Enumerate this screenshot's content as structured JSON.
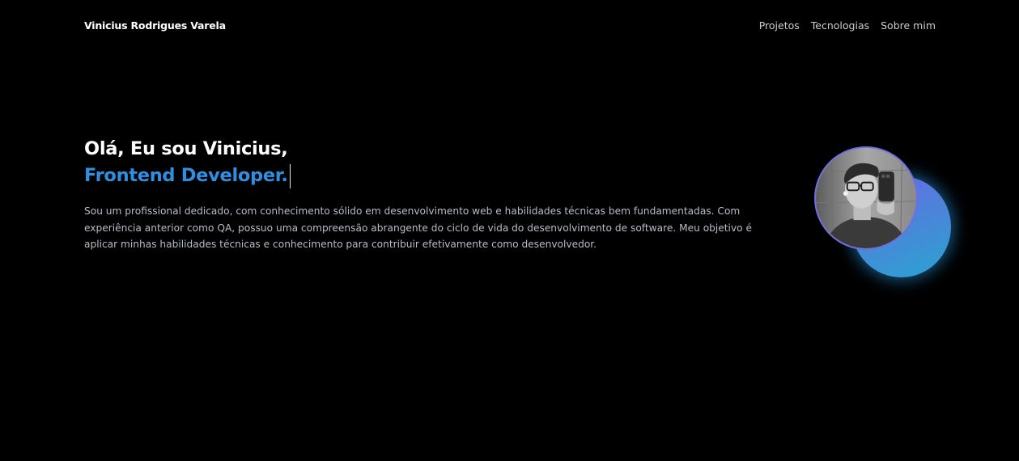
{
  "header": {
    "brand": "Vinicius Rodrigues Varela",
    "nav": [
      {
        "label": "Projetos"
      },
      {
        "label": "Tecnologias"
      },
      {
        "label": "Sobre mim"
      }
    ]
  },
  "hero": {
    "greeting": "Olá, Eu sou Vinicius,",
    "role": "Frontend Developer.",
    "bio": "Sou um profissional dedicado, com conhecimento sólido em desenvolvimento web e habilidades técnicas bem fundamentadas. Com experiência anterior como QA, possuo uma compreensão abrangente do ciclo de vida do desenvolvimento de software. Meu objetivo é aplicar minhas habilidades técnicas e conhecimento para contribuir efetivamente como desenvolvedor."
  },
  "colors": {
    "background": "#000000",
    "accent": "#2f8fe0",
    "glow_start": "#6a67e6",
    "glow_end": "#2aa3d2"
  }
}
